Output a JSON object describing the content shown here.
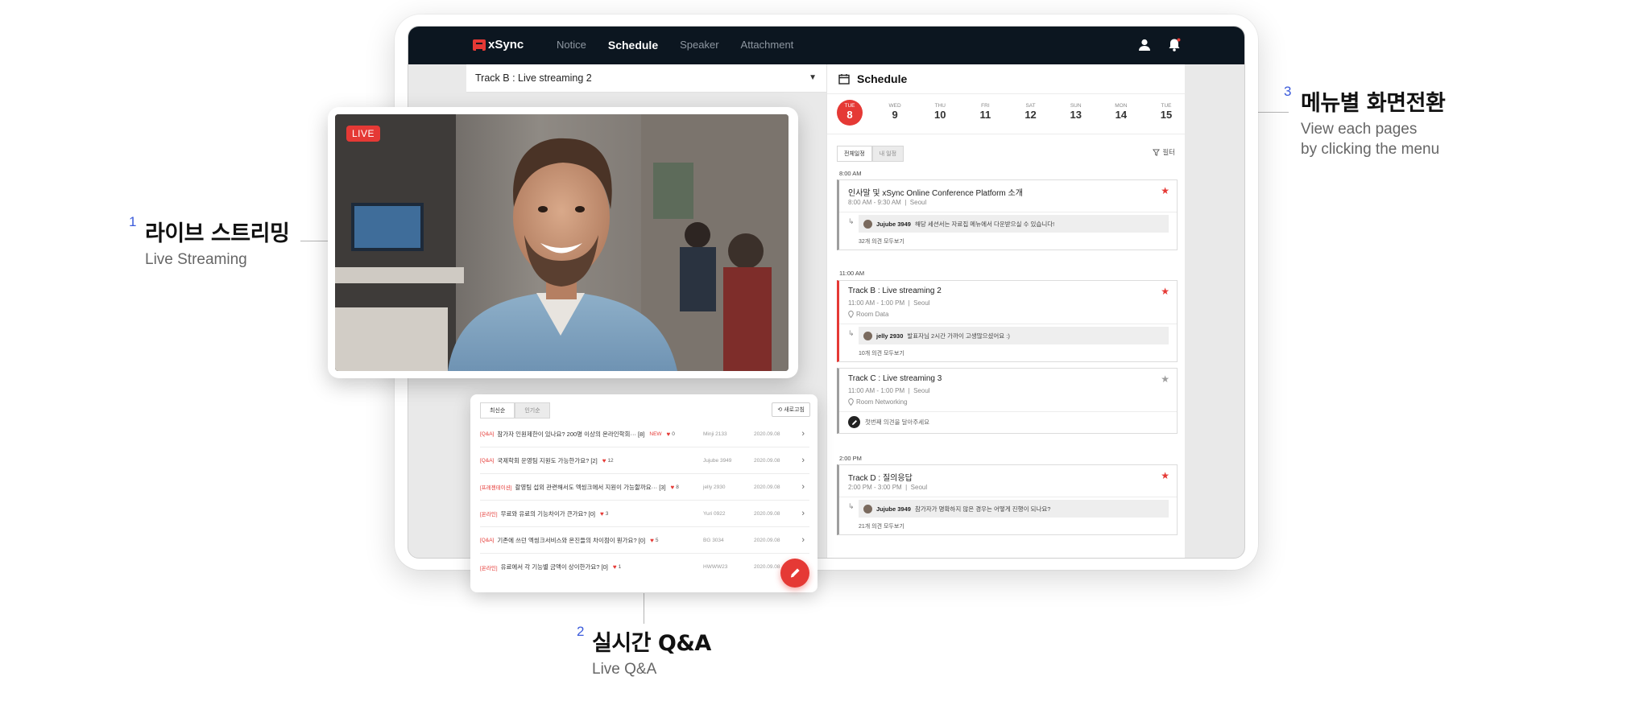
{
  "annotations": {
    "live_streaming": {
      "num": "1",
      "title": "라이브 스트리밍",
      "subtitle": "Live Streaming"
    },
    "live_qa": {
      "num": "2",
      "title": "실시간 Q&A",
      "subtitle": "Live Q&A"
    },
    "menu_switch": {
      "num": "3",
      "title": "메뉴별 화면전환",
      "subtitle_line1": "View each pages",
      "subtitle_line2": "by clicking the menu"
    }
  },
  "navbar": {
    "logo_text": "xSync",
    "menu": [
      "Notice",
      "Schedule",
      "Speaker",
      "Attachment"
    ],
    "active": "Schedule"
  },
  "track_select": {
    "value": "Track B : Live streaming 2"
  },
  "video": {
    "live_label": "LIVE"
  },
  "schedule": {
    "title": "Schedule",
    "days": [
      {
        "dow": "TUE",
        "num": "8",
        "active": true
      },
      {
        "dow": "WED",
        "num": "9"
      },
      {
        "dow": "THU",
        "num": "10"
      },
      {
        "dow": "FRI",
        "num": "11"
      },
      {
        "dow": "SAT",
        "num": "12"
      },
      {
        "dow": "SUN",
        "num": "13"
      },
      {
        "dow": "MON",
        "num": "14"
      },
      {
        "dow": "TUE",
        "num": "15"
      }
    ],
    "seg_all": "전체일정",
    "seg_mine": "내 일정",
    "filter_label": "필터",
    "times": [
      "8:00 AM",
      "11:00 AM",
      "2:00 PM"
    ],
    "cards": [
      {
        "title": "인사말 및 xSync Online Conference Platform 소개",
        "time": "8:00 AM - 9:30 AM",
        "location": "Seoul",
        "comment_user": "Jujube 3949",
        "comment_text": "해당 세션서는 자료집 메뉴에서 다운받으실 수 있습니다!",
        "comment_count": "32개 의견 모두보기"
      },
      {
        "title": "Track B : Live streaming 2",
        "time": "11:00 AM - 1:00 PM",
        "location": "Seoul",
        "room": "Room Data",
        "comment_user": "jelly 2930",
        "comment_text": "발표자님 2시간 가까이 고생많으셨어요 :)",
        "comment_count": "10개 의견 모두보기"
      },
      {
        "title": "Track C : Live streaming 3",
        "time": "11:00 AM - 1:00 PM",
        "location": "Seoul",
        "room": "Room Networking",
        "write_prompt": "첫번째 의견을 달아주세요"
      },
      {
        "title": "Track D : 질의응답",
        "time": "2:00 PM - 3:00 PM",
        "location": "Seoul",
        "comment_user": "Jujube 3949",
        "comment_text": "참가자가 명확하지 않은 경우는 어떻게 진행이 되나요?",
        "comment_count": "21개 의견 모두보기"
      }
    ]
  },
  "qa": {
    "tab_latest": "최신순",
    "tab_popular": "인기순",
    "refresh_label": "새로고침",
    "rows": [
      {
        "cat": "[Q&A]",
        "q": "참가자 인원제한이 있나요? 200명 이상의 온라인학회··· [8]",
        "new": "NEW",
        "likes": "0",
        "user": "Minji 2133",
        "date": "2020.09.08"
      },
      {
        "cat": "[Q&A]",
        "q": "국제학회 운영팀 지원도 가능한가요? [2]",
        "likes": "12",
        "user": "Jujube 3949",
        "date": "2020.09.08"
      },
      {
        "cat": "[프레젠테이션]",
        "q": "촬영팀 섭외 관련해서도 엑씽크에서 지원이 가능할까요··· [3]",
        "likes": "8",
        "user": "jelly 2930",
        "date": "2020.09.08"
      },
      {
        "cat": "[온라인]",
        "q": "무료와 유료의 기능차이가 큰가요? [0]",
        "likes": "3",
        "user": "Yuri 0922",
        "date": "2020.09.08"
      },
      {
        "cat": "[Q&A]",
        "q": "기존에 쓰던 엑씽크서비스와 온진들의 차이점이 뭔가요? [0]",
        "likes": "5",
        "user": "BG 3034",
        "date": "2020.09.08"
      },
      {
        "cat": "[온라인]",
        "q": "유료에서 각 기능별 금액이 상이한가요? [0]",
        "likes": "1",
        "user": "HWWW23",
        "date": "2020.09.08"
      }
    ]
  },
  "colors": {
    "accent": "#e53935",
    "navbar": "#0c1620",
    "annotation_number": "#3b5bdb"
  },
  "icons": [
    "user-icon",
    "bell-icon",
    "calendar-icon",
    "star-icon",
    "pin-icon",
    "reply-arrow-icon",
    "filter-icon",
    "refresh-icon",
    "chevron-right-icon",
    "pencil-icon",
    "heart-icon"
  ]
}
